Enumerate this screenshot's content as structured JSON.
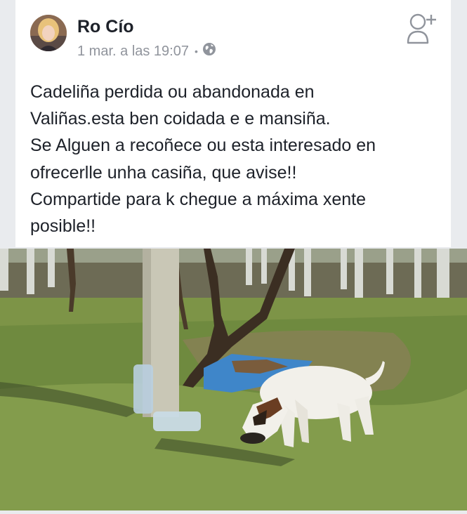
{
  "post": {
    "author": "Ro Cío",
    "timestamp": "1 mar. a las 19:07",
    "separator": "•",
    "privacy_icon": "globe-icon",
    "action_icon": "add-friend-icon",
    "text_lines": [
      "Cadeliña perdida ou abandonada en",
      "Valiñas.esta ben coidada e e mansiña.",
      "Se Alguen a recoñece ou esta interesado en",
      "ofrecerlle unha casiña, que avise!!",
      "Compartide para k chegue a máxima xente",
      "posible!!"
    ]
  },
  "colors": {
    "card_bg": "#ffffff",
    "page_bg": "#e9ebee",
    "name_text": "#1d2129",
    "meta_text": "#90949c"
  }
}
